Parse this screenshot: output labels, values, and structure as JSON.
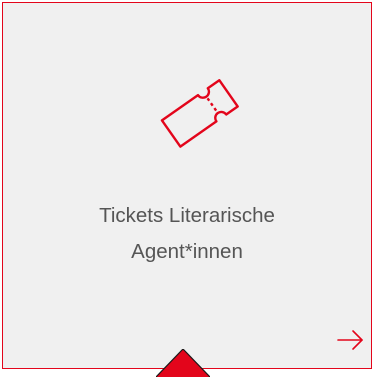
{
  "tile": {
    "title_line1": "Tickets Literarische",
    "title_line2": "Agent*innen",
    "icon": "ticket-icon",
    "action_icon": "arrow-right-icon"
  },
  "colors": {
    "accent": "#e3051b",
    "tile_background": "#f0f0f0",
    "text": "#555555"
  }
}
